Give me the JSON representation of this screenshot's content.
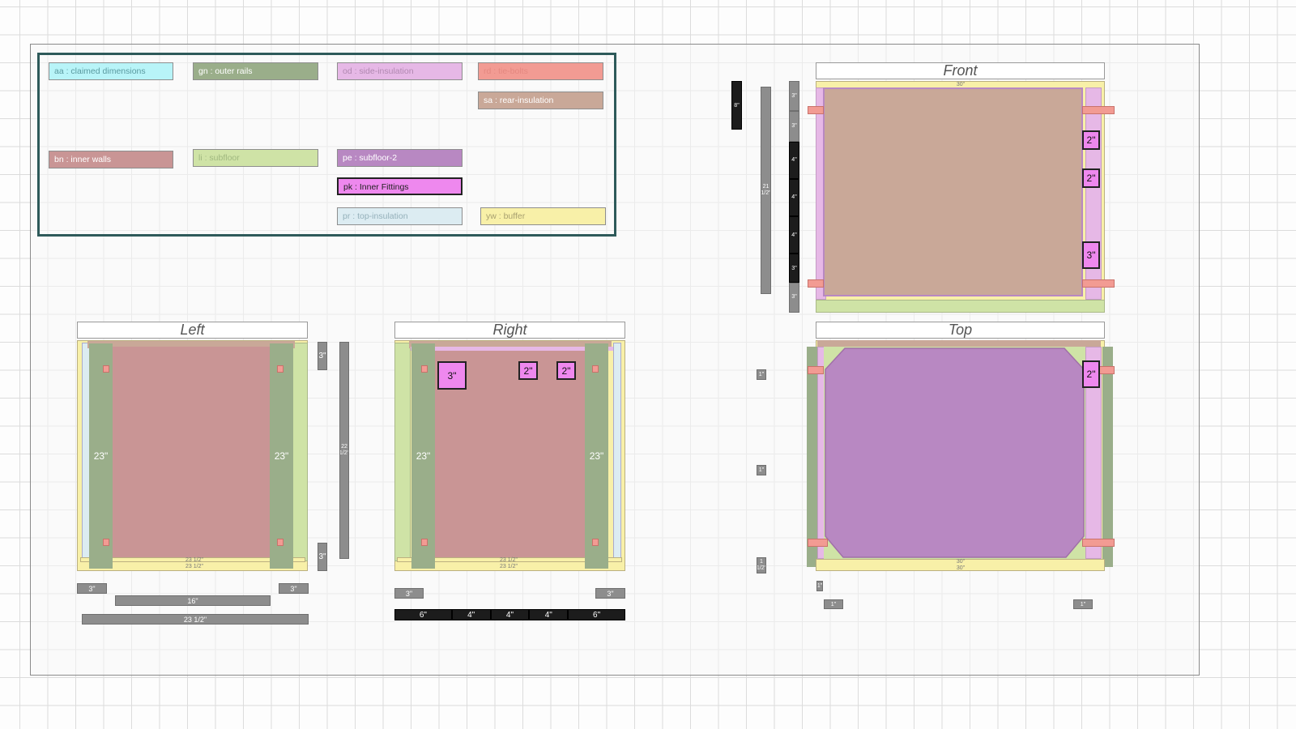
{
  "legend": [
    {
      "code": "aa : claimed dimensions",
      "color": "#b8f4f8",
      "text": "#5a9aa0"
    },
    {
      "code": "gn : outer rails",
      "color": "#9aae8a",
      "text": "#ffffff"
    },
    {
      "code": "od : side-insulation",
      "color": "#e6b8e6",
      "text": "#b088b0"
    },
    {
      "code": "rd : tie-bolts",
      "color": "#f29b93",
      "text": "#e0857e"
    },
    {
      "code": "sa : rear-insulation",
      "color": "#c9a898",
      "text": "#ffffff"
    },
    {
      "code": "bn : inner walls",
      "color": "#c99595",
      "text": "#ffffff"
    },
    {
      "code": "li : subfloor",
      "color": "#cfe3a6",
      "text": "#a0b880"
    },
    {
      "code": "pe : subfloor-2",
      "color": "#b888c2",
      "text": "#ffffff"
    },
    {
      "code": "pk : Inner Fittings",
      "color": "#ee88ee",
      "text": "#222222"
    },
    {
      "code": "pr : top-insulation",
      "color": "#dcecf2",
      "text": "#94b0ba"
    },
    {
      "code": "yw : buffer",
      "color": "#f8f0a8",
      "text": "#a8a070"
    }
  ],
  "views": {
    "left": "Left",
    "right": "Right",
    "front": "Front",
    "top": "Top"
  },
  "dims": {
    "rail_23": "23\"",
    "d3": "3\"",
    "d16": "16\"",
    "d23_5": "23 1/2\"",
    "d22_5": "22 1/2\"",
    "d21_5": "21 1/2\"",
    "d30": "30\"",
    "d1": "1\"",
    "d1_5": "1 1/2\"",
    "d2": "2\"",
    "d4": "4\"",
    "d6": "6\"",
    "d8": "8\""
  },
  "fittings": {
    "f2": "2\"",
    "f3": "3\""
  },
  "rules": {
    "front_black": [
      "3\"",
      "3\"",
      "4\"",
      "4\"",
      "4\"",
      "3\"",
      "3\""
    ],
    "right_bottom": [
      "6\"",
      "4\"",
      "4\"",
      "4\"",
      "6\""
    ]
  }
}
